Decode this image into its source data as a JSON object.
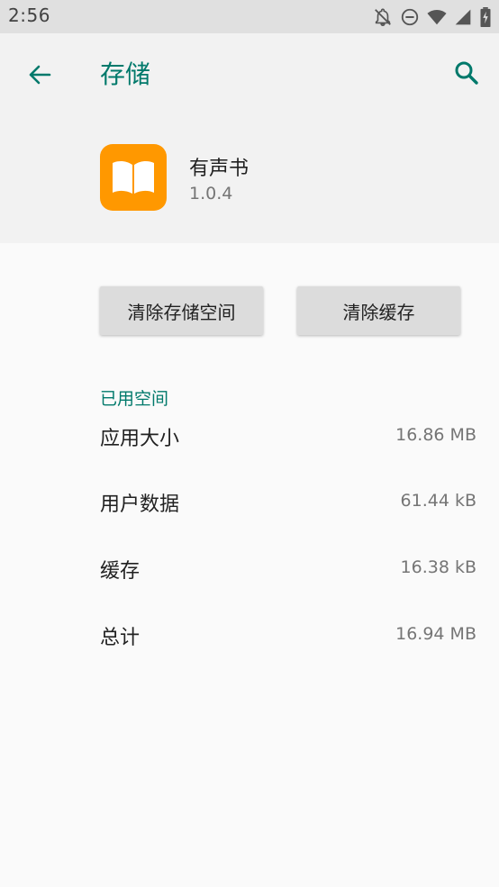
{
  "status_bar": {
    "time": "2:56"
  },
  "header": {
    "title": "存储"
  },
  "app": {
    "name": "有声书",
    "version": "1.0.4"
  },
  "buttons": {
    "clear_storage": "清除存储空间",
    "clear_cache": "清除缓存"
  },
  "section": {
    "title": "已用空间"
  },
  "storage_rows": [
    {
      "label": "应用大小",
      "value": "16.86 MB"
    },
    {
      "label": "用户数据",
      "value": "61.44 kB"
    },
    {
      "label": "缓存",
      "value": "16.38 kB"
    },
    {
      "label": "总计",
      "value": "16.94 MB"
    }
  ],
  "colors": {
    "accent": "#00796b",
    "app_icon": "#ff9800"
  },
  "icons": {
    "status": [
      "notifications-off-icon",
      "do-not-disturb-icon",
      "wifi-icon",
      "cellular-signal-icon",
      "battery-charging-icon"
    ],
    "header": [
      "back-arrow-icon",
      "search-icon"
    ],
    "app": "open-book-icon"
  }
}
